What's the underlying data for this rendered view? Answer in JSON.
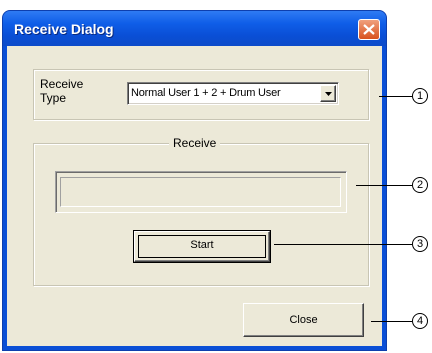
{
  "window": {
    "title": "Receive Dialog"
  },
  "receive_type": {
    "label_line1": "Receive",
    "label_line2": "Type",
    "selected": "Normal User 1 + 2 + Drum User"
  },
  "receive_group": {
    "title": "Receive",
    "progress_fraction": 0
  },
  "buttons": {
    "start": "Start",
    "close": "Close"
  },
  "callouts": [
    "1",
    "2",
    "3",
    "4"
  ]
}
